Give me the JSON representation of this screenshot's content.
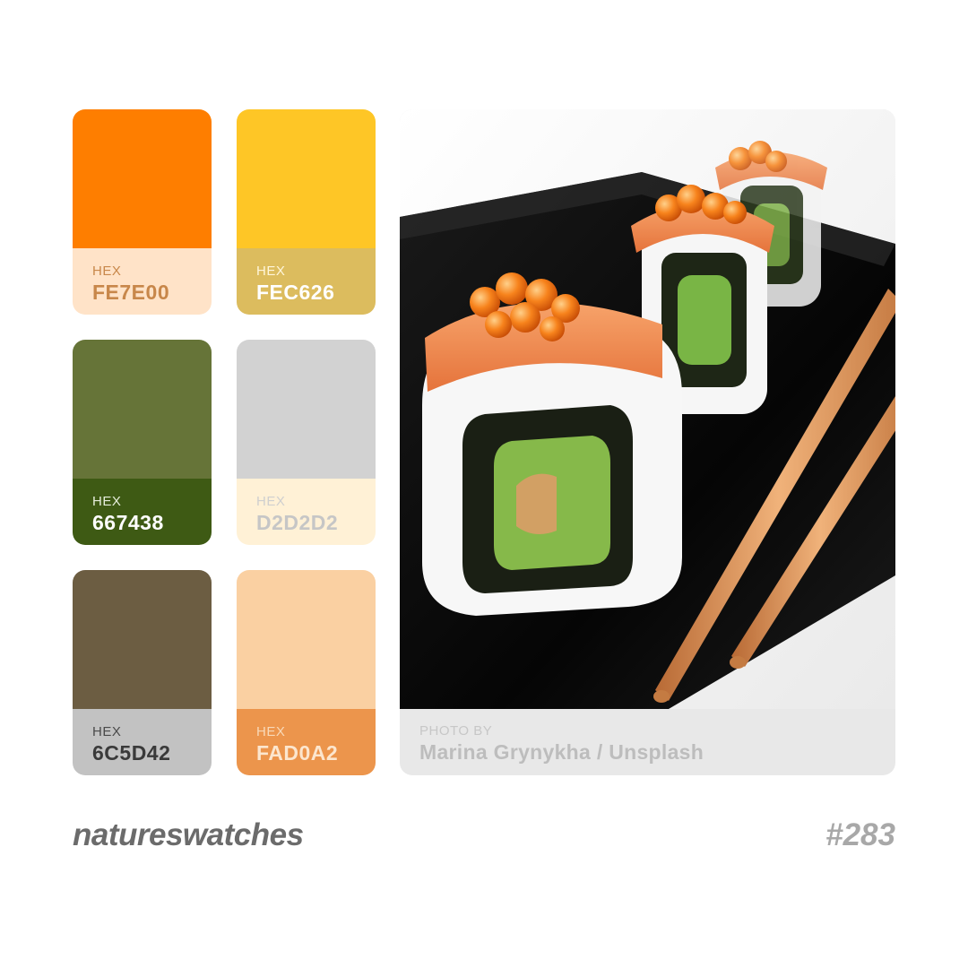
{
  "swatches": [
    {
      "hex_label": "HEX",
      "hex": "FE7E00",
      "color": "#FE7E00",
      "label_bg": "#FFE3C8",
      "hex_label_color": "#C8874A",
      "hex_color": "#C8874A"
    },
    {
      "hex_label": "HEX",
      "hex": "FEC626",
      "color": "#FEC626",
      "label_bg": "#DCBC5E",
      "hex_label_color": "#FFF6DA",
      "hex_color": "#FFFFFF"
    },
    {
      "hex_label": "HEX",
      "hex": "667438",
      "color": "#667438",
      "label_bg": "#3E5A14",
      "hex_label_color": "#E6EEDC",
      "hex_color": "#FFFFFF"
    },
    {
      "hex_label": "HEX",
      "hex": "D2D2D2",
      "color": "#D2D2D2",
      "label_bg": "#FFF1D6",
      "hex_label_color": "#CFCFCF",
      "hex_color": "#C6C6C6"
    },
    {
      "hex_label": "HEX",
      "hex": "6C5D42",
      "color": "#6C5D42",
      "label_bg": "#C2C2C2",
      "hex_label_color": "#4A4A4A",
      "hex_color": "#3A3A3A"
    },
    {
      "hex_label": "HEX",
      "hex": "FAD0A2",
      "color": "#FAD0A2",
      "label_bg": "#EC954C",
      "hex_label_color": "#F8D9B8",
      "hex_color": "#FCE6CE"
    }
  ],
  "photo": {
    "credit_label": "PHOTO BY",
    "credit_name": "Marina Grynykha / Unsplash"
  },
  "brand": "natureswatches",
  "issue": "#283"
}
